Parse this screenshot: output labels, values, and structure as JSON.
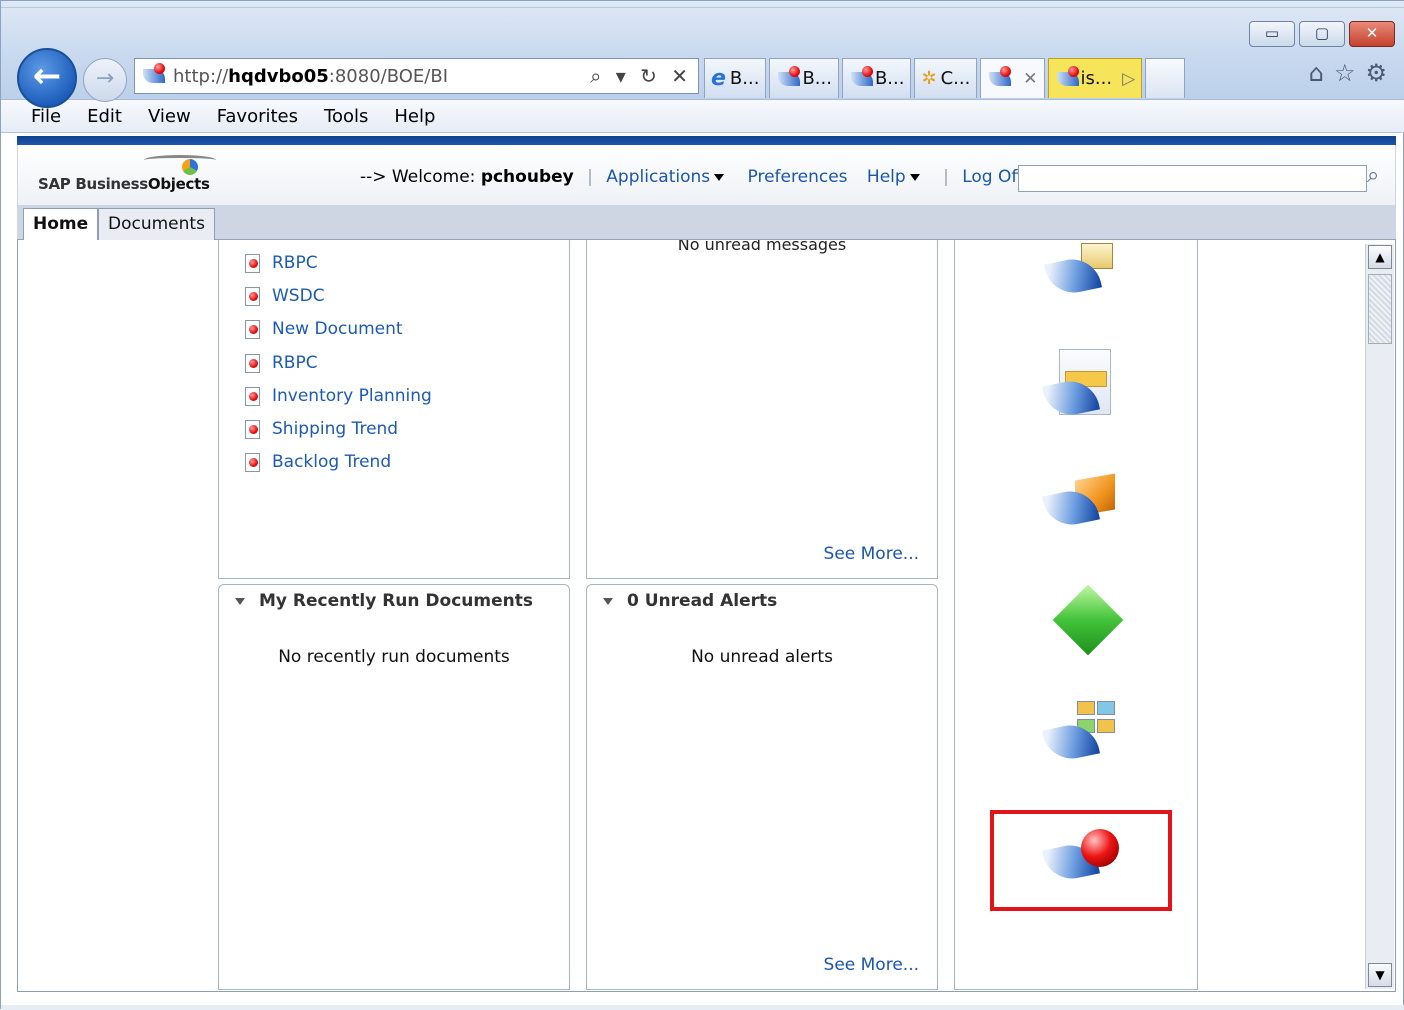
{
  "browser": {
    "url_prefix": "http://",
    "url_host": "hqdvbo05",
    "url_rest": ":8080/BOE/BI",
    "addr_tools": "⌕ ▾ ↻ ✕",
    "tabs": [
      "B...",
      "B...",
      "B...",
      "C...",
      "",
      "is..."
    ],
    "window_buttons": [
      "▭",
      "▢",
      "✕"
    ]
  },
  "menubar": [
    "File",
    "Edit",
    "View",
    "Favorites",
    "Tools",
    "Help"
  ],
  "header": {
    "logo_sap": "SAP Business",
    "logo_objects": "Objects",
    "welcome_prefix": "--> Welcome:",
    "username": "pchoubey",
    "applications": "Applications",
    "preferences": "Preferences",
    "help": "Help",
    "logoff": "Log Off",
    "search_value": ""
  },
  "apptabs": [
    "Home",
    "Documents"
  ],
  "recent_documents": [
    "RBPC",
    "WSDC",
    "New Document",
    "RBPC",
    "Inventory Planning",
    "Shipping Trend",
    "Backlog Trend"
  ],
  "messages_panel": {
    "text": "No unread messages",
    "see_more": "See More..."
  },
  "recently_run": {
    "title": "My Recently Run Documents",
    "message": "No recently run documents"
  },
  "alerts": {
    "title": "0 Unread Alerts",
    "message": "No unread alerts",
    "see_more": "See More..."
  },
  "colors": {
    "sap_blue": "#1d57ac",
    "link": "#1a55b0",
    "highlight": "#e3131b"
  }
}
